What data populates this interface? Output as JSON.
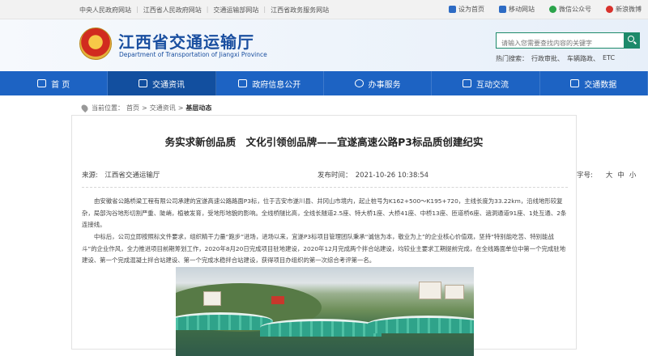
{
  "topbar": {
    "links": [
      "中央人民政府网站",
      "江西省人民政府网站",
      "交通运输部网站",
      "江西省政务服务网站"
    ],
    "right": [
      {
        "label": "设为首页",
        "icon": "home-icon",
        "color": "#2d6bc4"
      },
      {
        "label": "移动网站",
        "icon": "mobile-icon",
        "color": "#2d6bc4"
      },
      {
        "label": "微信公众号",
        "icon": "wechat-icon",
        "color": "#2aa34a"
      },
      {
        "label": "新浪微博",
        "icon": "weibo-icon",
        "color": "#d8322c"
      }
    ]
  },
  "header": {
    "title": "江西省交通运输厅",
    "subtitle": "Department of Transportation of Jiangxi Province",
    "search_placeholder": "请输入您需要查找内容的关键字",
    "hot_label": "热门搜索：",
    "hot_terms": [
      "行政审批、",
      "车辆路政、",
      "ETC"
    ]
  },
  "nav": {
    "items": [
      {
        "label": "首 页",
        "icon": "home-grid-icon"
      },
      {
        "label": "交通资讯",
        "icon": "news-icon"
      },
      {
        "label": "政府信息公开",
        "icon": "building-icon"
      },
      {
        "label": "办事服务",
        "icon": "user-service-icon"
      },
      {
        "label": "互动交流",
        "icon": "chat-icon"
      },
      {
        "label": "交通数据",
        "icon": "data-icon"
      }
    ]
  },
  "breadcrumb": {
    "prefix": "当前位置：",
    "items": [
      "首页",
      "交通资讯",
      "基层动态"
    ],
    "sep": ">"
  },
  "article": {
    "title": "务实求新创品质　文化引领创品牌——宜遂高速公路P3标品质创建纪实",
    "source": "来源:　江西省交通运输厅",
    "time": "发布时间：　2021-10-26 10:38:54",
    "fontsize_label": "字号:",
    "fontsizes": [
      "大",
      "中",
      "小"
    ],
    "paragraphs": [
      "由安徽省公路桥梁工程有限公司承建的宜遂高速公路路面P3标，位于吉安市遂川县、井冈山市境内，起止桩号为K162+500～K195+720，主线长度为33.22km，沿线地形较复杂，局部沟谷地形切割严重、陡峭，植被发育，受地形地貌的影响。全线桥隧比高，全线长隧道2.5座、特大桥1座、大桥41座、中桥13座、匝道桥6座、涵洞通道91座、1处互通、2条连接线。",
      "中标后，公司立即按照标文件要求，组织精干力量“跑步”进场，进场以来，宜遂P3标项目管理团队秉承“诚信为本，敬业为上”的企业核心价值观，坚持“特别能吃苦、特别能战斗”的企业作风，全力推进项目前期筹划工作，2020年8月20日完成项目驻地建设，2020年12月完成两个拌合站建设，均较业主要求工期提前完成，在全线路面单位中第一个完成驻地建设、第一个完成混凝土拌合站建设、第一个完成水稳拌合站建设，获得项目办组织的第一次综合考评第一名。"
    ]
  }
}
